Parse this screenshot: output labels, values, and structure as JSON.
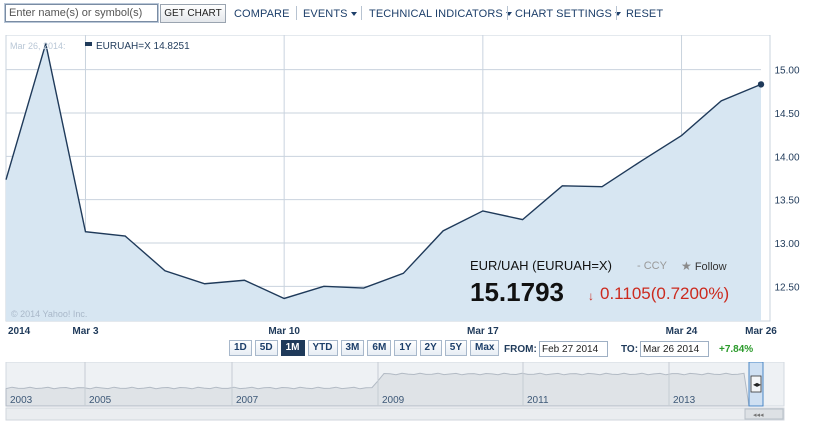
{
  "toolbar": {
    "search_placeholder": "Enter name(s) or symbol(s)",
    "get_chart": "GET CHART",
    "compare": "COMPARE",
    "events": "EVENTS",
    "technical_indicators": "TECHNICAL INDICATORS",
    "chart_settings": "CHART SETTINGS",
    "reset": "RESET"
  },
  "legend": {
    "date": "Mar 26, 2014:",
    "series_label": "EURUAH=X 14.8251"
  },
  "copyright": "© 2014 Yahoo! Inc.",
  "quote": {
    "name": "EUR/UAH (EURUAH=X)",
    "ccy": "- CCY",
    "follow": "Follow",
    "price": "15.1793",
    "change": "0.1105",
    "change_pct": "(0.7200%)"
  },
  "ranges": [
    {
      "label": "1D",
      "active": false
    },
    {
      "label": "5D",
      "active": false
    },
    {
      "label": "1M",
      "active": true
    },
    {
      "label": "YTD",
      "active": false
    },
    {
      "label": "3M",
      "active": false
    },
    {
      "label": "6M",
      "active": false
    },
    {
      "label": "1Y",
      "active": false
    },
    {
      "label": "2Y",
      "active": false
    },
    {
      "label": "5Y",
      "active": false
    },
    {
      "label": "Max",
      "active": false
    }
  ],
  "from": {
    "label": "FROM:",
    "value": "Feb 27 2014"
  },
  "to": {
    "label": "TO:",
    "value": "Mar 26 2014"
  },
  "period_change": "+7.84%",
  "navigator": {
    "years": [
      "2003",
      "2005",
      "2007",
      "2009",
      "2011",
      "2013"
    ]
  },
  "colors": {
    "line": "#1f3a5a",
    "fill": "#d7e6f2",
    "grid": "#c9d3de",
    "down": "#cc2a1e",
    "up": "#2a9a2a"
  },
  "chart_data": {
    "type": "area",
    "series": [
      {
        "name": "EURUAH=X",
        "x": [
          "2014-02-27",
          "2014-02-28",
          "2014-03-03",
          "2014-03-04",
          "2014-03-05",
          "2014-03-06",
          "2014-03-07",
          "2014-03-10",
          "2014-03-11",
          "2014-03-12",
          "2014-03-13",
          "2014-03-14",
          "2014-03-17",
          "2014-03-18",
          "2014-03-19",
          "2014-03-20",
          "2014-03-21",
          "2014-03-24",
          "2014-03-25",
          "2014-03-26"
        ],
        "values": [
          13.73,
          15.3,
          13.13,
          13.08,
          12.68,
          12.53,
          12.57,
          12.36,
          12.5,
          12.48,
          12.65,
          13.14,
          13.37,
          13.27,
          13.66,
          13.65,
          13.95,
          14.24,
          14.64,
          14.83
        ]
      }
    ],
    "ylim": [
      12.1,
      15.4
    ],
    "yticks": [
      12.5,
      13.0,
      13.5,
      14.0,
      14.5,
      15.0
    ],
    "ytick_labels": [
      "12.50",
      "13.00",
      "13.50",
      "14.00",
      "14.50",
      "15.00"
    ],
    "xticks": [
      {
        "date": "2014-02-27",
        "label": "2014"
      },
      {
        "date": "2014-03-03",
        "label": "Mar 3"
      },
      {
        "date": "2014-03-10",
        "label": "Mar 10"
      },
      {
        "date": "2014-03-17",
        "label": "Mar 17"
      },
      {
        "date": "2014-03-24",
        "label": "Mar 24"
      },
      {
        "date": "2014-03-26",
        "label": "Mar 26"
      }
    ],
    "grid": true,
    "legend": "top-left"
  }
}
